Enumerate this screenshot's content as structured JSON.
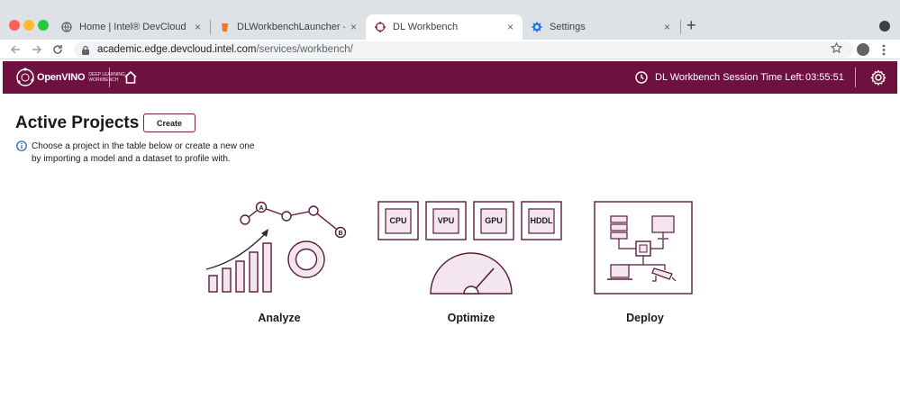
{
  "browser": {
    "tabs": [
      {
        "title": "Home | Intel® DevCloud",
        "icon": "globe-icon",
        "active": false
      },
      {
        "title": "DLWorkbenchLauncher - Jupyt",
        "icon": "jupyter-icon",
        "active": false
      },
      {
        "title": "DL Workbench",
        "icon": "dlworkbench-icon",
        "active": true
      },
      {
        "title": "Settings",
        "icon": "gear-icon",
        "active": false
      }
    ],
    "close_glyph": "×",
    "new_tab": "+",
    "url_host": "academic.edge.devcloud.intel.com",
    "url_path": "/services/workbench/",
    "colors": {
      "red": "#fe5f57",
      "yellow": "#febb2e",
      "green": "#28c840"
    }
  },
  "header": {
    "logo_text": "OpenVINO",
    "logo_sub_1": "DEEP LEARNING",
    "logo_sub_2": "WORKBENCH",
    "session_label": "DL Workbench Session Time Left:",
    "session_time": "03:55:51",
    "bg_color": "#6f1140"
  },
  "main": {
    "title": "Active Projects",
    "create_label": "Create",
    "info_line_1": "Choose a project in the table below or create a new one",
    "info_line_2": "by importing a model and a dataset to profile with."
  },
  "illustrations": {
    "analyze": {
      "label": "Analyze",
      "point_a": "A",
      "point_b": "B"
    },
    "optimize": {
      "label": "Optimize",
      "chips": [
        "CPU",
        "VPU",
        "GPU",
        "HDDL"
      ]
    },
    "deploy": {
      "label": "Deploy"
    }
  },
  "accent_color": "#7a1f4a"
}
